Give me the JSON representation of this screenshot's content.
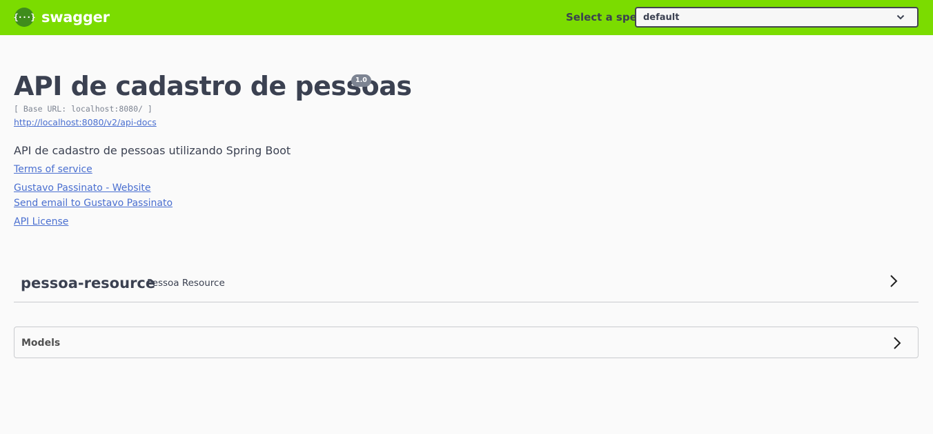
{
  "topbar": {
    "logo_glyph": "{···}",
    "brand": "swagger",
    "spec_label": "Select a spec",
    "spec_value": "default",
    "colors": {
      "bar": "#7bdc00",
      "logo": "#3f8c1c"
    }
  },
  "info": {
    "title": "API de cadastro de pessoas",
    "version": "1.0",
    "base_url": "[ Base URL: localhost:8080/ ]",
    "api_docs_url": "http://localhost:8080/v2/api-docs",
    "description": "API de cadastro de pessoas utilizando Spring Boot",
    "terms_link": "Terms of service",
    "website_link": "Gustavo Passinato - Website",
    "email_link": "Send email to Gustavo Passinato",
    "license_link": "API License"
  },
  "tags": [
    {
      "name": "pessoa-resource",
      "description": "Pessoa Resource"
    }
  ],
  "models": {
    "title": "Models"
  }
}
